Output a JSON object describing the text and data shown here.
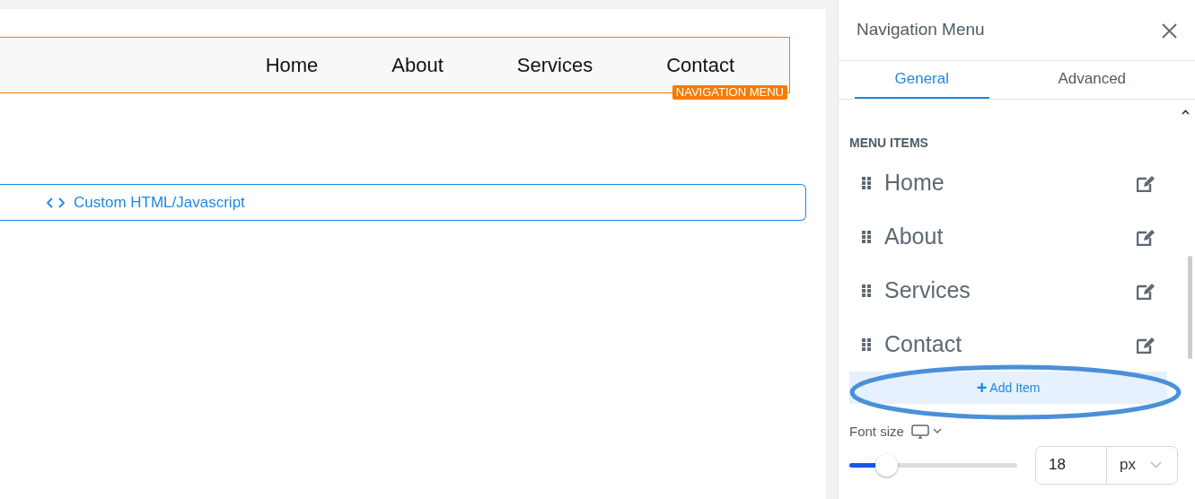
{
  "canvas": {
    "nav_items": [
      {
        "label": "Home"
      },
      {
        "label": "About"
      },
      {
        "label": "Services"
      },
      {
        "label": "Contact"
      }
    ],
    "element_tag": "NAVIGATION MENU",
    "custom_block": {
      "label": "Custom HTML/Javascript"
    }
  },
  "panel": {
    "title": "Navigation Menu",
    "tabs": [
      {
        "label": "General",
        "selected": true
      },
      {
        "label": "Advanced",
        "selected": false
      }
    ],
    "section_title": "MENU ITEMS",
    "menu_items": [
      {
        "label": "Home"
      },
      {
        "label": "About"
      },
      {
        "label": "Services"
      },
      {
        "label": "Contact"
      }
    ],
    "add_button": {
      "label": "Add Item",
      "icon": "+",
      "highlighted": true
    },
    "font_size": {
      "label": "Font size",
      "level": 0.22,
      "value": "18",
      "unit": "px"
    }
  }
}
